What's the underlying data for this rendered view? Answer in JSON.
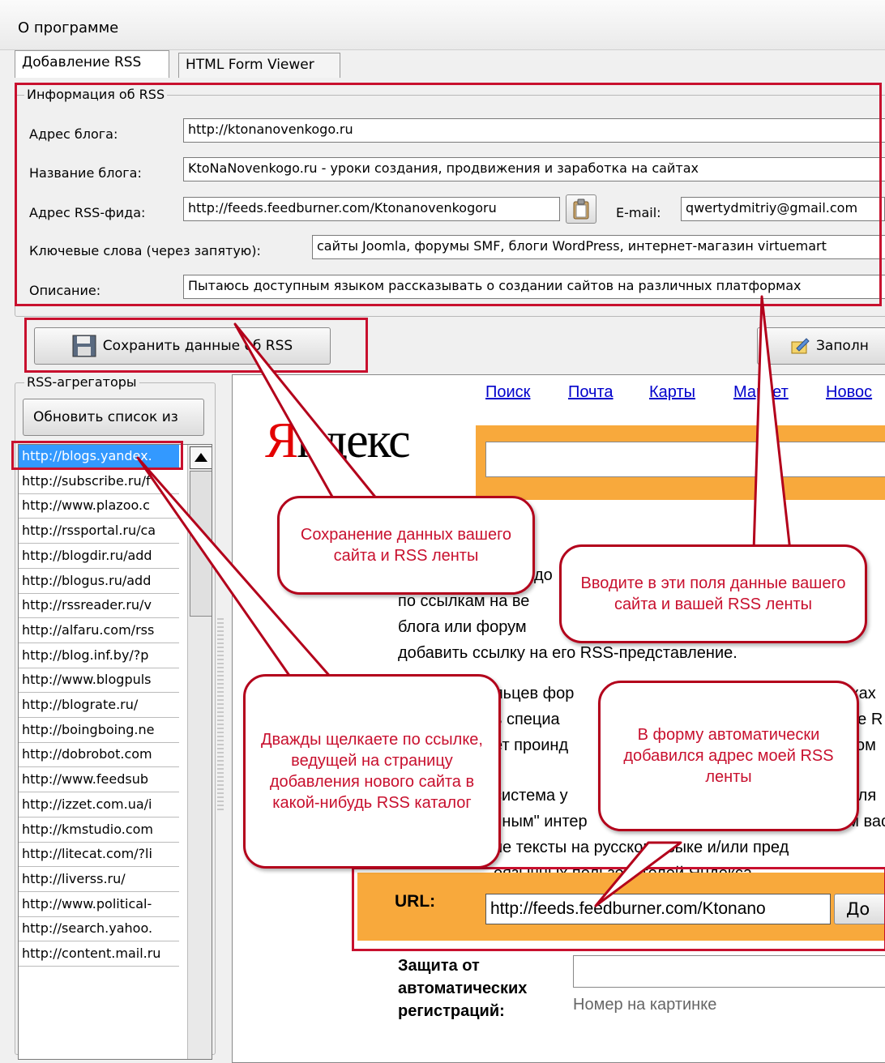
{
  "window": {
    "menu_title": "О программе"
  },
  "tabs": [
    {
      "label": "Добавление RSS"
    },
    {
      "label": "HTML Form Viewer"
    }
  ],
  "rss_info": {
    "group_title": "Информация об RSS",
    "blog_address_label": "Адрес блога:",
    "blog_address_value": "http://ktonanovenkogo.ru",
    "blog_name_label": "Название блога:",
    "blog_name_value": "KtoNaNovenkogo.ru - уроки создания, продвижения и заработка на сайтах",
    "feed_label": "Адрес RSS-фида:",
    "feed_value": "http://feeds.feedburner.com/Ktonanovenkogoru",
    "email_label": "E-mail:",
    "email_value": "qwertydmitriy@gmail.com",
    "keywords_label": "Ключевые слова (через запятую):",
    "keywords_value": "сайты Joomla, форумы SMF, блоги WordPress, интернет-магазин virtuemart",
    "description_label": "Описание:",
    "description_value": "Пытаюсь доступным языком рассказывать о создании сайтов на различных платформах"
  },
  "toolbar": {
    "save_label": "Сохранить данные об RSS",
    "fill_label": "Заполн"
  },
  "aggregators": {
    "group_title": "RSS-агрегаторы",
    "refresh_label": "Обновить список из",
    "items": [
      "http://blogs.yandex.",
      "http://subscribe.ru/f",
      "http://www.plazoo.c",
      "http://rssportal.ru/ca",
      "http://blogdir.ru/add",
      "http://blogus.ru/add",
      "http://rssreader.ru/v",
      "http://alfaru.com/rss",
      "http://blog.inf.by/?p",
      "http://www.blogpuls",
      "http://blograte.ru/",
      "http://boingboing.ne",
      "http://dobrobot.com",
      "http://www.feedsub",
      "http://izzet.com.ua/i",
      "http://kmstudio.com",
      "http://litecat.com/?li",
      "http://liverss.ru/",
      "http://www.political-",
      "http://search.yahoo.",
      "http://content.mail.ru"
    ]
  },
  "browser": {
    "nav_links": [
      "Поиск",
      "Почта",
      "Карты",
      "Маркет",
      "Новос"
    ],
    "logo_letter": "Я",
    "logo_rest": "ндекс",
    "body_lines": [
      "до",
      "по ссылкам на ве",
      "блога или форум",
      "добавить ссылку на его RSS-представление.",
      "льцев фор",
      "ь специа",
      "ет проинд",
      "система у",
      "чным\" интер",
      "не тексты на русском языке и/или пред",
      "оязычных пользователей Яндекса."
    ],
    "body_right_fragments": [
      "жках",
      "ие R",
      "ком",
      "для",
      "им вас"
    ],
    "url_label": "URL:",
    "url_value": "http://feeds.feedburner.com/Ktonano",
    "add_button": "До",
    "captcha_label_1": "Защита от",
    "captcha_label_2": "автоматических",
    "captcha_label_3": "регистраций:",
    "captcha_placeholder": "Номер на картинке"
  },
  "callouts": {
    "save": "Сохранение данных вашего сайта и RSS ленты",
    "fields": "Вводите в эти поля данные вашего сайта и вашей RSS ленты",
    "form": "В форму автоматически добавился адрес моей RSS ленты",
    "click": "Дважды щелкаете по ссылке, ведущей на страницу добавления нового сайта в какой-нибудь RSS каталог"
  },
  "colors": {
    "accent_red": "#c8102e",
    "selection": "#3399ff",
    "yandex_orange": "#f8a93c",
    "link_blue": "#0000cc"
  }
}
